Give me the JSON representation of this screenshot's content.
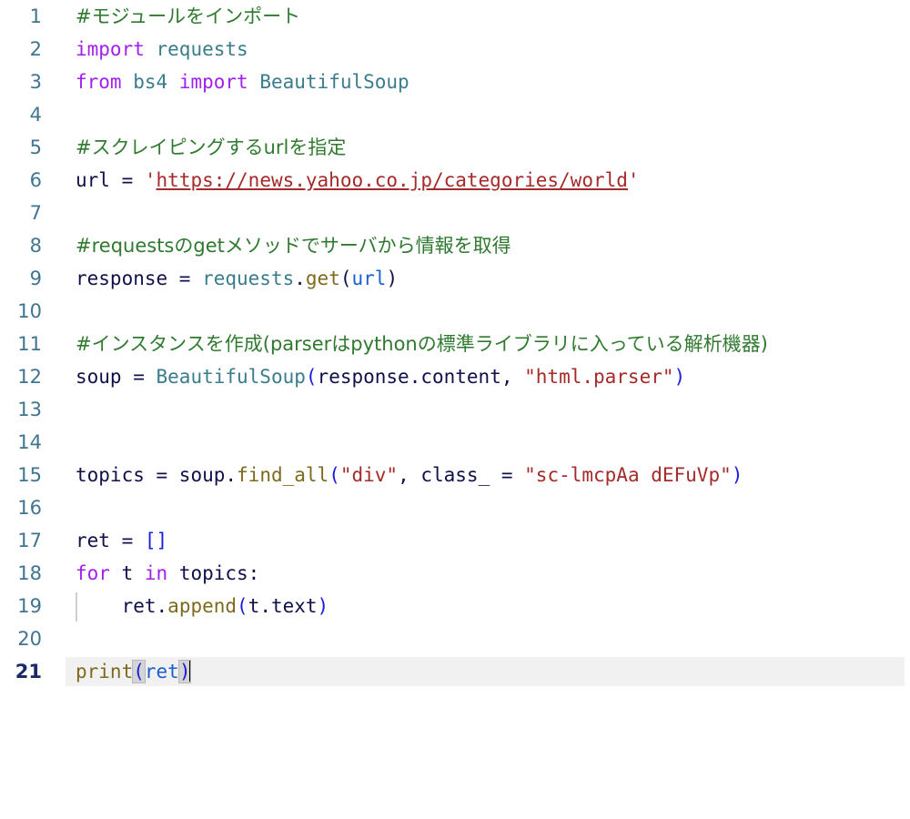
{
  "editor": {
    "language": "python",
    "total_lines": 21,
    "active_line": 21,
    "colors": {
      "background": "#ffffff",
      "gutter_text": "#3f7590",
      "active_gutter_text": "#1b2a66",
      "active_line_bg": "#f1f1f1",
      "comment": "#2f7a2f",
      "keyword": "#a020f0",
      "name": "#3a7c8c",
      "plain": "#10104a",
      "function": "#7d6a1e",
      "string": "#a52a2a",
      "bracket": "#1a1ae0",
      "argument": "#1a5fd0",
      "indent_guide": "#cfcfcf",
      "bracket_match_bg": "#d4d4d4"
    }
  },
  "gutter": {
    "numbers": [
      "1",
      "2",
      "3",
      "4",
      "5",
      "6",
      "7",
      "8",
      "9",
      "10",
      "11",
      "12",
      "13",
      "14",
      "15",
      "16",
      "17",
      "18",
      "19",
      "20",
      "21"
    ]
  },
  "code": {
    "lines": [
      {
        "number": "1",
        "text": "#モジュールをインポート"
      },
      {
        "number": "2",
        "text": "import requests"
      },
      {
        "number": "3",
        "text": "from bs4 import BeautifulSoup"
      },
      {
        "number": "4",
        "text": ""
      },
      {
        "number": "5",
        "text": "#スクレイピングするurlを指定"
      },
      {
        "number": "6",
        "text": "url = 'https://news.yahoo.co.jp/categories/world'"
      },
      {
        "number": "7",
        "text": ""
      },
      {
        "number": "8",
        "text": "#requestsのgetメソッドでサーバから情報を取得"
      },
      {
        "number": "9",
        "text": "response = requests.get(url)"
      },
      {
        "number": "10",
        "text": ""
      },
      {
        "number": "11",
        "text": "#インスタンスを作成(parserはpythonの標準ライブラリに入っている解析機器)"
      },
      {
        "number": "12",
        "text": "soup = BeautifulSoup(response.content, \"html.parser\")"
      },
      {
        "number": "13",
        "text": ""
      },
      {
        "number": "14",
        "text": ""
      },
      {
        "number": "15",
        "text": "topics = soup.find_all(\"div\", class_ = \"sc-lmcpAa dEFuVp\")"
      },
      {
        "number": "16",
        "text": ""
      },
      {
        "number": "17",
        "text": "ret = []"
      },
      {
        "number": "18",
        "text": "for t in topics:"
      },
      {
        "number": "19",
        "text": "    ret.append(t.text)"
      },
      {
        "number": "20",
        "text": ""
      },
      {
        "number": "21",
        "text": "print(ret)"
      }
    ],
    "tokens": {
      "l1_comment": "#モジュールをインポート",
      "l2_kw_import": "import",
      "l2_module": "requests",
      "l3_kw_from": "from",
      "l3_module": "bs4",
      "l3_kw_import": "import",
      "l3_class": "BeautifulSoup",
      "l5_comment": "#スクレイピングするurlを指定",
      "l6_var": "url",
      "l6_op": " = ",
      "l6_quote_open": "'",
      "l6_url": "https://news.yahoo.co.jp/categories/world",
      "l6_quote_close": "'",
      "l8_comment": "#requestsのgetメソッドでサーバから情報を取得",
      "l9_var": "response",
      "l9_op": " = ",
      "l9_module": "requests",
      "l9_dot": ".",
      "l9_method": "get",
      "l9_paren_open": "(",
      "l9_arg": "url",
      "l9_paren_close": ")",
      "l11_comment": "#インスタンスを作成(parserはpythonの標準ライブラリに入っている解析機器)",
      "l12_var": "soup",
      "l12_op": " = ",
      "l12_class": "BeautifulSoup",
      "l12_paren_open": "(",
      "l12_arg1": "response.content",
      "l12_comma": ", ",
      "l12_arg2": "\"html.parser\"",
      "l12_paren_close": ")",
      "l15_var": "topics",
      "l15_op": " = ",
      "l15_obj": "soup",
      "l15_dot": ".",
      "l15_method": "find_all",
      "l15_paren_open": "(",
      "l15_arg1": "\"div\"",
      "l15_comma": ", ",
      "l15_kwarg": "class_",
      "l15_kw_op": " = ",
      "l15_arg2": "\"sc-lmcpAa dEFuVp\"",
      "l15_paren_close": ")",
      "l17_var": "ret",
      "l17_op": " = ",
      "l17_list": "[]",
      "l18_kw_for": "for",
      "l18_iter": " t ",
      "l18_kw_in": "in",
      "l18_seq": " topics:",
      "l19_indent": "    ",
      "l19_var": "ret",
      "l19_dot": ".",
      "l19_method": "append",
      "l19_paren_open": "(",
      "l19_arg": "t.text",
      "l19_paren_close": ")",
      "l21_func": "print",
      "l21_paren_open": "(",
      "l21_arg": "ret",
      "l21_paren_close": ")"
    }
  }
}
